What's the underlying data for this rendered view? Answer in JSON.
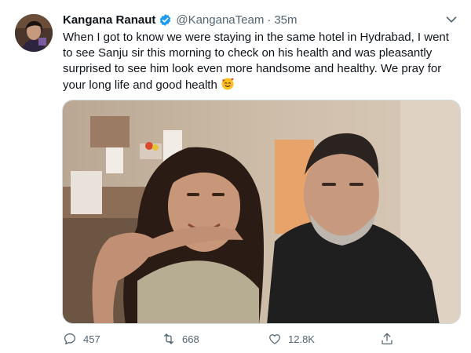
{
  "tweet": {
    "author_name": "Kangana Ranaut",
    "handle": "@KanganaTeam",
    "separator": "·",
    "time": "35m",
    "verified_color": "#1d9bf0",
    "text": "When I got to know we were staying in the same hotel in Hydrabad, I went to see Sanju sir this morning to check on his health and was pleasantly surprised to see him look even more handsome and healthy. We pray for your long life and good health",
    "emoji": "smiling-face-with-hearts"
  },
  "actions": {
    "replies": "457",
    "retweets": "668",
    "likes": "12.8K"
  },
  "icons": {
    "reply": "reply-icon",
    "retweet": "retweet-icon",
    "like": "heart-icon",
    "share": "share-icon",
    "more": "chevron-down-icon"
  }
}
